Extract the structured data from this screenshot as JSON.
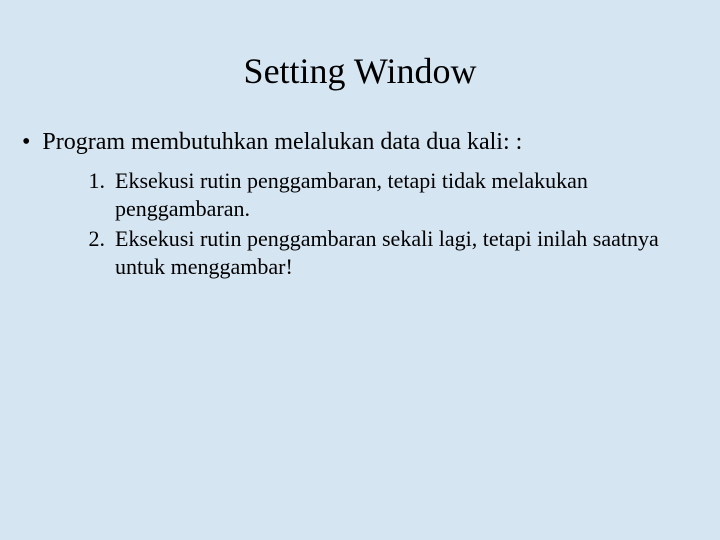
{
  "title": "Setting Window",
  "bullet": {
    "marker": "•",
    "text": "Program membutuhkan melalukan data dua kali: :"
  },
  "numbered": [
    {
      "marker": "1.",
      "text": "Eksekusi rutin penggambaran, tetapi tidak melakukan penggambaran."
    },
    {
      "marker": "2.",
      "text": "Eksekusi rutin penggambaran sekali lagi, tetapi inilah saatnya untuk menggambar!"
    }
  ]
}
